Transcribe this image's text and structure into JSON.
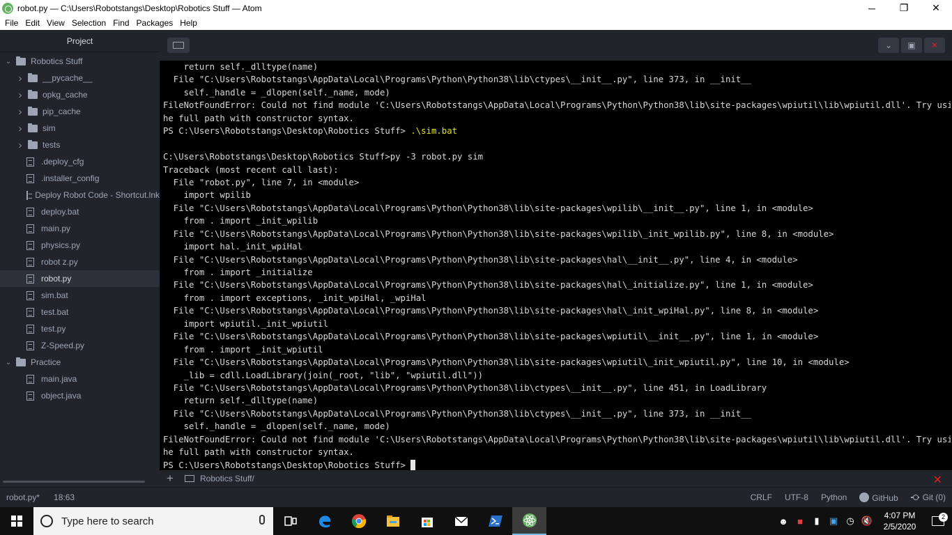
{
  "window": {
    "title": "robot.py — C:\\Users\\Robotstangs\\Desktop\\Robotics Stuff — Atom",
    "minimize": "─",
    "restore": "❐",
    "close": "✕"
  },
  "menu": [
    "File",
    "Edit",
    "View",
    "Selection",
    "Find",
    "Packages",
    "Help"
  ],
  "tree": {
    "title": "Project",
    "items": [
      {
        "label": "Robotics Stuff",
        "type": "root"
      },
      {
        "label": "__pycache__",
        "type": "folder"
      },
      {
        "label": "opkg_cache",
        "type": "folder"
      },
      {
        "label": "pip_cache",
        "type": "folder"
      },
      {
        "label": "sim",
        "type": "folder"
      },
      {
        "label": "tests",
        "type": "folder"
      },
      {
        "label": ".deploy_cfg",
        "type": "file"
      },
      {
        "label": ".installer_config",
        "type": "file"
      },
      {
        "label": "Deploy Robot Code - Shortcut.lnk",
        "type": "file"
      },
      {
        "label": "deploy.bat",
        "type": "file"
      },
      {
        "label": "main.py",
        "type": "file"
      },
      {
        "label": "physics.py",
        "type": "file"
      },
      {
        "label": "robot z.py",
        "type": "file"
      },
      {
        "label": "robot.py",
        "type": "file",
        "selected": true
      },
      {
        "label": "sim.bat",
        "type": "file"
      },
      {
        "label": "test.bat",
        "type": "file"
      },
      {
        "label": "test.py",
        "type": "file"
      },
      {
        "label": "Z-Speed.py",
        "type": "file"
      },
      {
        "label": "Practice",
        "type": "root"
      },
      {
        "label": "main.java",
        "type": "file"
      },
      {
        "label": "object.java",
        "type": "file"
      }
    ]
  },
  "terminal": {
    "lines": [
      "    return self._dlltype(name)",
      "  File \"C:\\Users\\Robotstangs\\AppData\\Local\\Programs\\Python\\Python38\\lib\\ctypes\\__init__.py\", line 373, in __init__",
      "    self._handle = _dlopen(self._name, mode)",
      "FileNotFoundError: Could not find module 'C:\\Users\\Robotstangs\\AppData\\Local\\Programs\\Python\\Python38\\lib\\site-packages\\wpiutil\\lib\\wpiutil.dll'. Try using t",
      "he full path with constructor syntax.",
      "PS C:\\Users\\Robotstangs\\Desktop\\Robotics Stuff> ",
      "",
      "C:\\Users\\Robotstangs\\Desktop\\Robotics Stuff>py -3 robot.py sim",
      "Traceback (most recent call last):",
      "  File \"robot.py\", line 7, in <module>",
      "    import wpilib",
      "  File \"C:\\Users\\Robotstangs\\AppData\\Local\\Programs\\Python\\Python38\\lib\\site-packages\\wpilib\\__init__.py\", line 1, in <module>",
      "    from . import _init_wpilib",
      "  File \"C:\\Users\\Robotstangs\\AppData\\Local\\Programs\\Python\\Python38\\lib\\site-packages\\wpilib\\_init_wpilib.py\", line 8, in <module>",
      "    import hal._init_wpiHal",
      "  File \"C:\\Users\\Robotstangs\\AppData\\Local\\Programs\\Python\\Python38\\lib\\site-packages\\hal\\__init__.py\", line 4, in <module>",
      "    from . import _initialize",
      "  File \"C:\\Users\\Robotstangs\\AppData\\Local\\Programs\\Python\\Python38\\lib\\site-packages\\hal\\_initialize.py\", line 1, in <module>",
      "    from . import exceptions, _init_wpiHal, _wpiHal",
      "  File \"C:\\Users\\Robotstangs\\AppData\\Local\\Programs\\Python\\Python38\\lib\\site-packages\\hal\\_init_wpiHal.py\", line 8, in <module>",
      "    import wpiutil._init_wpiutil",
      "  File \"C:\\Users\\Robotstangs\\AppData\\Local\\Programs\\Python\\Python38\\lib\\site-packages\\wpiutil\\__init__.py\", line 1, in <module>",
      "    from . import _init_wpiutil",
      "  File \"C:\\Users\\Robotstangs\\AppData\\Local\\Programs\\Python\\Python38\\lib\\site-packages\\wpiutil\\_init_wpiutil.py\", line 10, in <module>",
      "    _lib = cdll.LoadLibrary(join(_root, \"lib\", \"wpiutil.dll\"))",
      "  File \"C:\\Users\\Robotstangs\\AppData\\Local\\Programs\\Python\\Python38\\lib\\ctypes\\__init__.py\", line 451, in LoadLibrary",
      "    return self._dlltype(name)",
      "  File \"C:\\Users\\Robotstangs\\AppData\\Local\\Programs\\Python\\Python38\\lib\\ctypes\\__init__.py\", line 373, in __init__",
      "    self._handle = _dlopen(self._name, mode)",
      "FileNotFoundError: Could not find module 'C:\\Users\\Robotstangs\\AppData\\Local\\Programs\\Python\\Python38\\lib\\site-packages\\wpiutil\\lib\\wpiutil.dll'. Try using t",
      "he full path with constructor syntax.",
      "PS C:\\Users\\Robotstangs\\Desktop\\Robotics Stuff> "
    ],
    "highlight_line": 5,
    "highlight_text": ".\\sim.bat",
    "tab_label": "Robotics Stuff/",
    "add_label": "+",
    "close_label": "✕"
  },
  "status": {
    "file": "robot.py*",
    "cursor": "18:63",
    "line_ending": "CRLF",
    "encoding": "UTF-8",
    "grammar": "Python",
    "github": "GitHub",
    "git": "Git (0)"
  },
  "taskbar": {
    "search_placeholder": "Type here to search",
    "time": "4:07 PM",
    "date": "2/5/2020",
    "notifications": "2"
  },
  "colors": {
    "panel": "#21252b",
    "terminal_bg": "#000000",
    "prompt_highlight": "#e5e510",
    "close_red": "#e02020"
  }
}
